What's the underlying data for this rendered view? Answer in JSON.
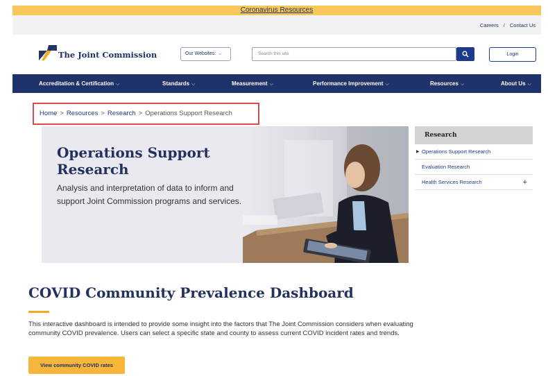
{
  "banner": {
    "text": "Coronavirus Resources"
  },
  "utility": {
    "careers": "Careers",
    "separator": "/",
    "contact": "Contact Us"
  },
  "header": {
    "logo_text": "The Joint Commission",
    "websites_label": "Our Websites:",
    "search_placeholder": "Search this site",
    "login_label": "Login"
  },
  "nav": {
    "items": [
      {
        "label": "Accreditation & Certification"
      },
      {
        "label": "Standards"
      },
      {
        "label": "Measurement"
      },
      {
        "label": "Performance Improvement"
      },
      {
        "label": "Resources"
      },
      {
        "label": "About Us"
      }
    ],
    "chevron": "⌵"
  },
  "breadcrumb": {
    "items": [
      "Home",
      "Resources",
      "Research",
      "Operations Support Research"
    ],
    "separator": ">"
  },
  "hero": {
    "title": "Operations Support Research",
    "description": "Analysis and interpretation of data to inform and support Joint Commission programs and services."
  },
  "sidebar": {
    "heading": "Research",
    "items": [
      {
        "label": "Operations Support Research"
      },
      {
        "label": "Evaluation Research"
      },
      {
        "label": "Health Services Research"
      }
    ],
    "plus": "+"
  },
  "covid": {
    "title": "COVID Community Prevalence Dashboard",
    "description": "This interactive dashboard is intended to provide some insight into the factors that The Joint Commission considers when evaluating community COVID prevalence. Users can select a specific state and county to assess current COVID incident rates and trends.",
    "button_label": "View community COVID rates"
  },
  "colors": {
    "navy": "#1f3269",
    "accent_yellow": "#f7c75a",
    "button_orange": "#f7b53a",
    "link_blue": "#1e3a8a",
    "highlight_red": "#d94a4a"
  }
}
